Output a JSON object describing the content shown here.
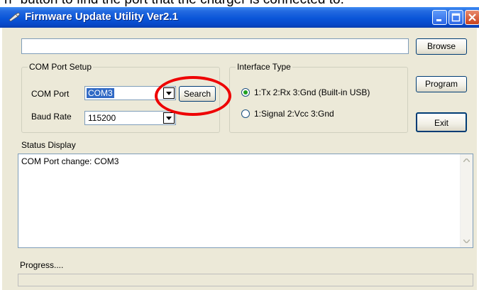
{
  "caption": "h\" button to find the port that the charger is connected to.",
  "window": {
    "title": "Firmware Update Utility Ver2.1",
    "file_path": "",
    "browse_label": "Browse",
    "program_label": "Program",
    "exit_label": "Exit"
  },
  "com_setup": {
    "legend": "COM Port Setup",
    "port_label": "COM Port",
    "port_value": "COM3",
    "search_label": "Search",
    "baud_label": "Baud Rate",
    "baud_value": "115200"
  },
  "interface": {
    "legend": "Interface Type",
    "options": [
      {
        "label": "1:Tx 2:Rx 3:Gnd (Built-in USB)",
        "selected": true
      },
      {
        "label": "1:Signal 2:Vcc 3:Gnd",
        "selected": false
      }
    ]
  },
  "status": {
    "label": "Status Display",
    "text": "COM Port change: COM3"
  },
  "progress": {
    "label": "Progress....",
    "value": 0
  },
  "colors": {
    "titlebar": "#0a55d8",
    "highlight": "#e00000",
    "window_bg": "#ece9d8"
  }
}
